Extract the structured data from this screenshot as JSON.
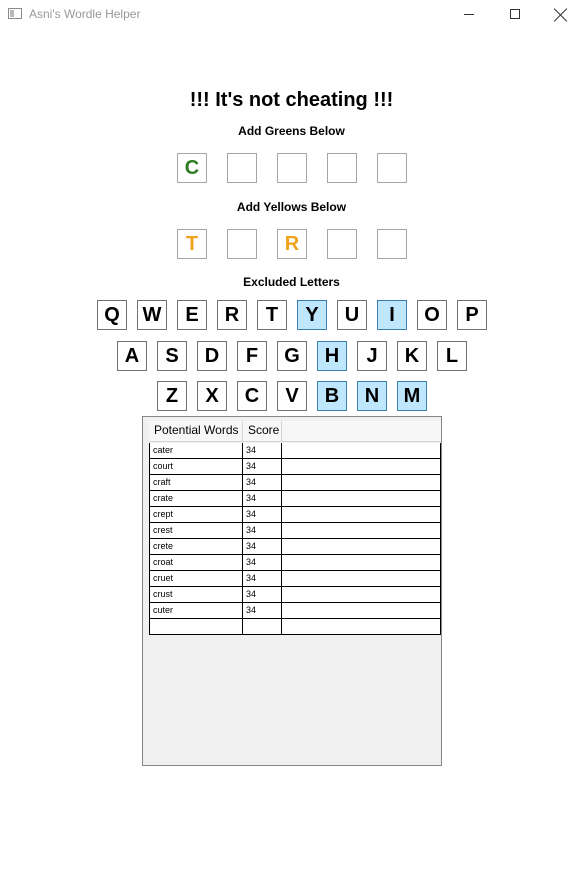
{
  "window": {
    "title": "Asni's Wordle Helper"
  },
  "heading": "!!! It's not cheating !!!",
  "greens": {
    "label": "Add Greens Below",
    "letters": [
      "C",
      "",
      "",
      "",
      ""
    ]
  },
  "yellows": {
    "label": "Add Yellows Below",
    "letters": [
      "T",
      "",
      "R",
      "",
      ""
    ]
  },
  "excluded": {
    "label": "Excluded Letters",
    "rows": [
      [
        "Q",
        "W",
        "E",
        "R",
        "T",
        "Y",
        "U",
        "I",
        "O",
        "P"
      ],
      [
        "A",
        "S",
        "D",
        "F",
        "G",
        "H",
        "J",
        "K",
        "L"
      ],
      [
        "Z",
        "X",
        "C",
        "V",
        "B",
        "N",
        "M"
      ]
    ],
    "selected": [
      "Y",
      "I",
      "H",
      "B",
      "N",
      "M"
    ]
  },
  "results": {
    "columns": [
      "Potential Words",
      "Score"
    ],
    "rows": [
      [
        "cater",
        "34"
      ],
      [
        "court",
        "34"
      ],
      [
        "craft",
        "34"
      ],
      [
        "crate",
        "34"
      ],
      [
        "crept",
        "34"
      ],
      [
        "crest",
        "34"
      ],
      [
        "crete",
        "34"
      ],
      [
        "croat",
        "34"
      ],
      [
        "cruet",
        "34"
      ],
      [
        "crust",
        "34"
      ],
      [
        "cuter",
        "34"
      ],
      [
        "",
        ""
      ]
    ]
  },
  "colors": {
    "green": "#2e7d22",
    "yellow": "#f0a21a",
    "excluded_bg": "#bee6fd"
  }
}
